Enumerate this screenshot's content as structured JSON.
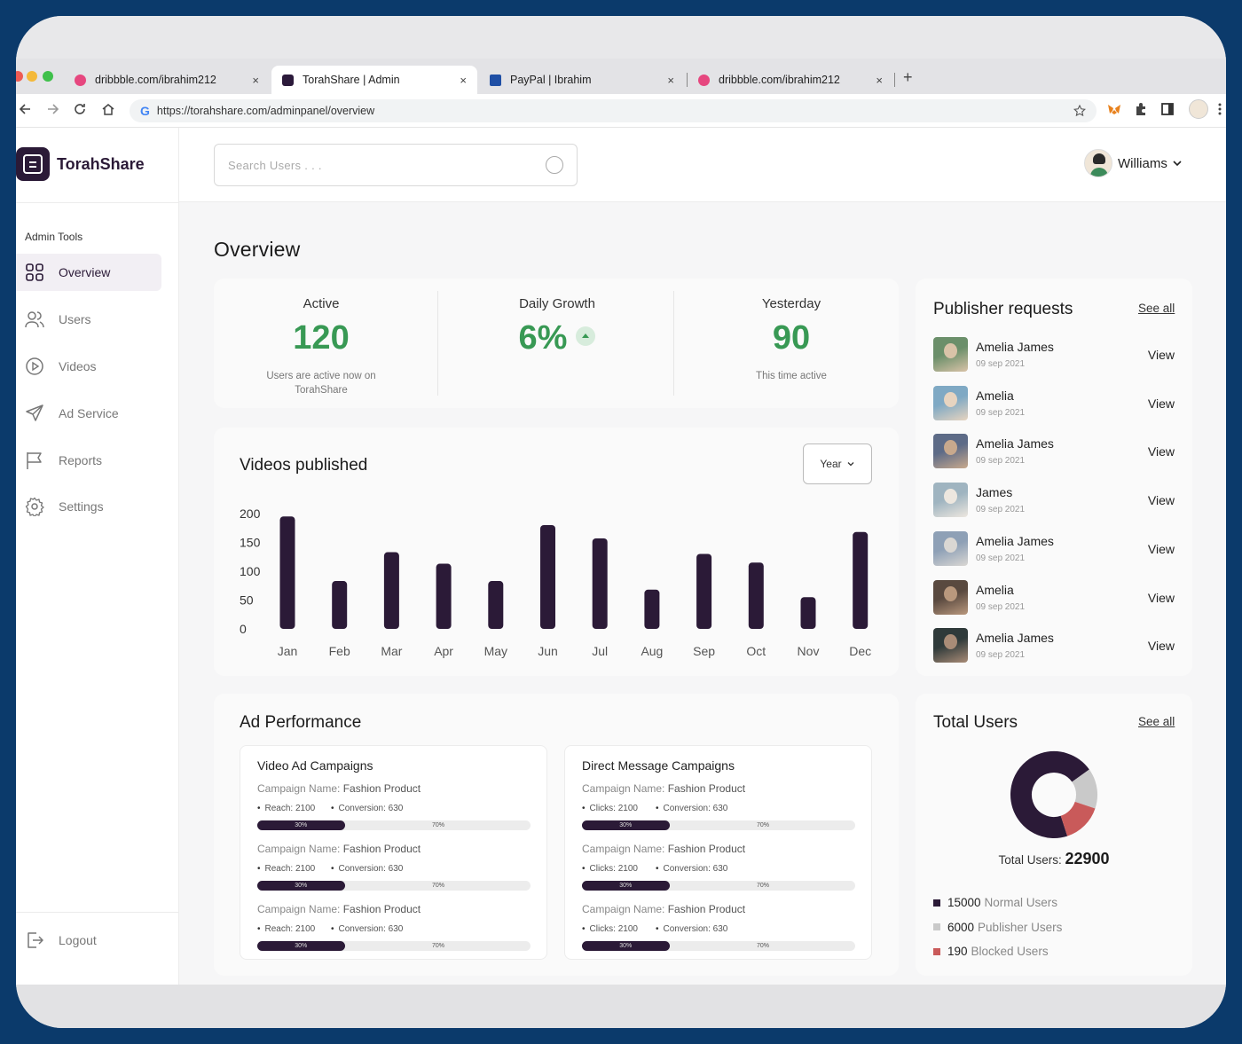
{
  "browser": {
    "tabs": [
      {
        "label": "dribbble.com/ibrahim212",
        "active": false
      },
      {
        "label": "TorahShare | Admin",
        "active": true
      },
      {
        "label": "PayPal | Ibrahim",
        "active": false
      },
      {
        "label": "dribbble.com/ibrahim212",
        "active": false
      }
    ],
    "close_glyph": "×",
    "new_tab_glyph": "+",
    "url": "https://torahshare.com/adminpanel/overview",
    "google_glyph": "G"
  },
  "brand": {
    "name": "TorahShare",
    "color": "#2b1a37"
  },
  "sidebar": {
    "section_title": "Admin Tools",
    "items": [
      {
        "label": "Overview",
        "icon": "grid-icon",
        "active": true
      },
      {
        "label": "Users",
        "icon": "users-icon",
        "active": false
      },
      {
        "label": "Videos",
        "icon": "play-circle-icon",
        "active": false
      },
      {
        "label": "Ad Service",
        "icon": "send-icon",
        "active": false
      },
      {
        "label": "Reports",
        "icon": "flag-icon",
        "active": false
      },
      {
        "label": "Settings",
        "icon": "gear-icon",
        "active": false
      }
    ],
    "logout_label": "Logout"
  },
  "header": {
    "search_placeholder": "Search Users . . .",
    "user_name": "Williams"
  },
  "main": {
    "title": "Overview",
    "stats": [
      {
        "title": "Active",
        "value": "120",
        "subtitle": "Users are active now on TorahShare"
      },
      {
        "title": "Daily Growth",
        "value": "6%",
        "subtitle": ""
      },
      {
        "title": "Yesterday",
        "value": "90",
        "subtitle": "This time active"
      }
    ],
    "videos_title": "Videos published",
    "year_label": "Year"
  },
  "chart_data": {
    "type": "bar",
    "title": "Videos published",
    "categories": [
      "Jan",
      "Feb",
      "Mar",
      "Apr",
      "May",
      "Jun",
      "Jul",
      "Aug",
      "Sep",
      "Oct",
      "Nov",
      "Dec"
    ],
    "values": [
      195,
      83,
      133,
      113,
      83,
      180,
      157,
      68,
      130,
      115,
      55,
      168
    ],
    "yticks": [
      200,
      150,
      100,
      50,
      0
    ],
    "ylim": [
      0,
      200
    ],
    "bar_color": "#2b1a37",
    "grid": false
  },
  "publisher_requests": {
    "title": "Publisher requests",
    "see_all": "See all",
    "view_label": "View",
    "items": [
      {
        "name": "Amelia James",
        "date": "09 sep 2021"
      },
      {
        "name": "Amelia",
        "date": "09 sep 2021"
      },
      {
        "name": "Amelia James",
        "date": "09 sep 2021"
      },
      {
        "name": "James",
        "date": "09 sep 2021"
      },
      {
        "name": "Amelia James",
        "date": "09 sep 2021"
      },
      {
        "name": "Amelia",
        "date": "09 sep 2021"
      },
      {
        "name": "Amelia James",
        "date": "09 sep 2021"
      }
    ]
  },
  "ad_performance": {
    "title": "Ad Performance",
    "boxes": [
      {
        "title": "Video Ad Campaigns",
        "campaigns": [
          {
            "name_label": "Campaign Name:",
            "name": "Fashion Product",
            "m1": "Reach: 2100",
            "m2": "Conversion: 630",
            "fill": "30%",
            "rest": "70%",
            "fill_fraction": 0.32
          },
          {
            "name_label": "Campaign Name:",
            "name": "Fashion Product",
            "m1": "Reach: 2100",
            "m2": "Conversion: 630",
            "fill": "30%",
            "rest": "70%",
            "fill_fraction": 0.32
          },
          {
            "name_label": "Campaign Name:",
            "name": "Fashion Product",
            "m1": "Reach: 2100",
            "m2": "Conversion: 630",
            "fill": "30%",
            "rest": "70%",
            "fill_fraction": 0.32
          }
        ]
      },
      {
        "title": "Direct Message Campaigns",
        "campaigns": [
          {
            "name_label": "Campaign Name:",
            "name": "Fashion Product",
            "m1": "Clicks: 2100",
            "m2": "Conversion: 630",
            "fill": "30%",
            "rest": "70%",
            "fill_fraction": 0.32
          },
          {
            "name_label": "Campaign Name:",
            "name": "Fashion Product",
            "m1": "Clicks: 2100",
            "m2": "Conversion: 630",
            "fill": "30%",
            "rest": "70%",
            "fill_fraction": 0.32
          },
          {
            "name_label": "Campaign Name:",
            "name": "Fashion Product",
            "m1": "Clicks: 2100",
            "m2": "Conversion: 630",
            "fill": "30%",
            "rest": "70%",
            "fill_fraction": 0.32
          }
        ]
      }
    ]
  },
  "total_users": {
    "title": "Total Users",
    "see_all": "See all",
    "total_label": "Total Users:",
    "total_value": "22900",
    "segments": [
      {
        "value": "15000",
        "label": "Normal Users",
        "color": "#2b1a37",
        "amount": 15000
      },
      {
        "value": "6000",
        "label": "Publisher Users",
        "color": "#c9c9c9",
        "amount": 6000
      },
      {
        "value": "190",
        "label": "Blocked Users",
        "color": "#c95a5a",
        "amount": 190
      }
    ]
  }
}
